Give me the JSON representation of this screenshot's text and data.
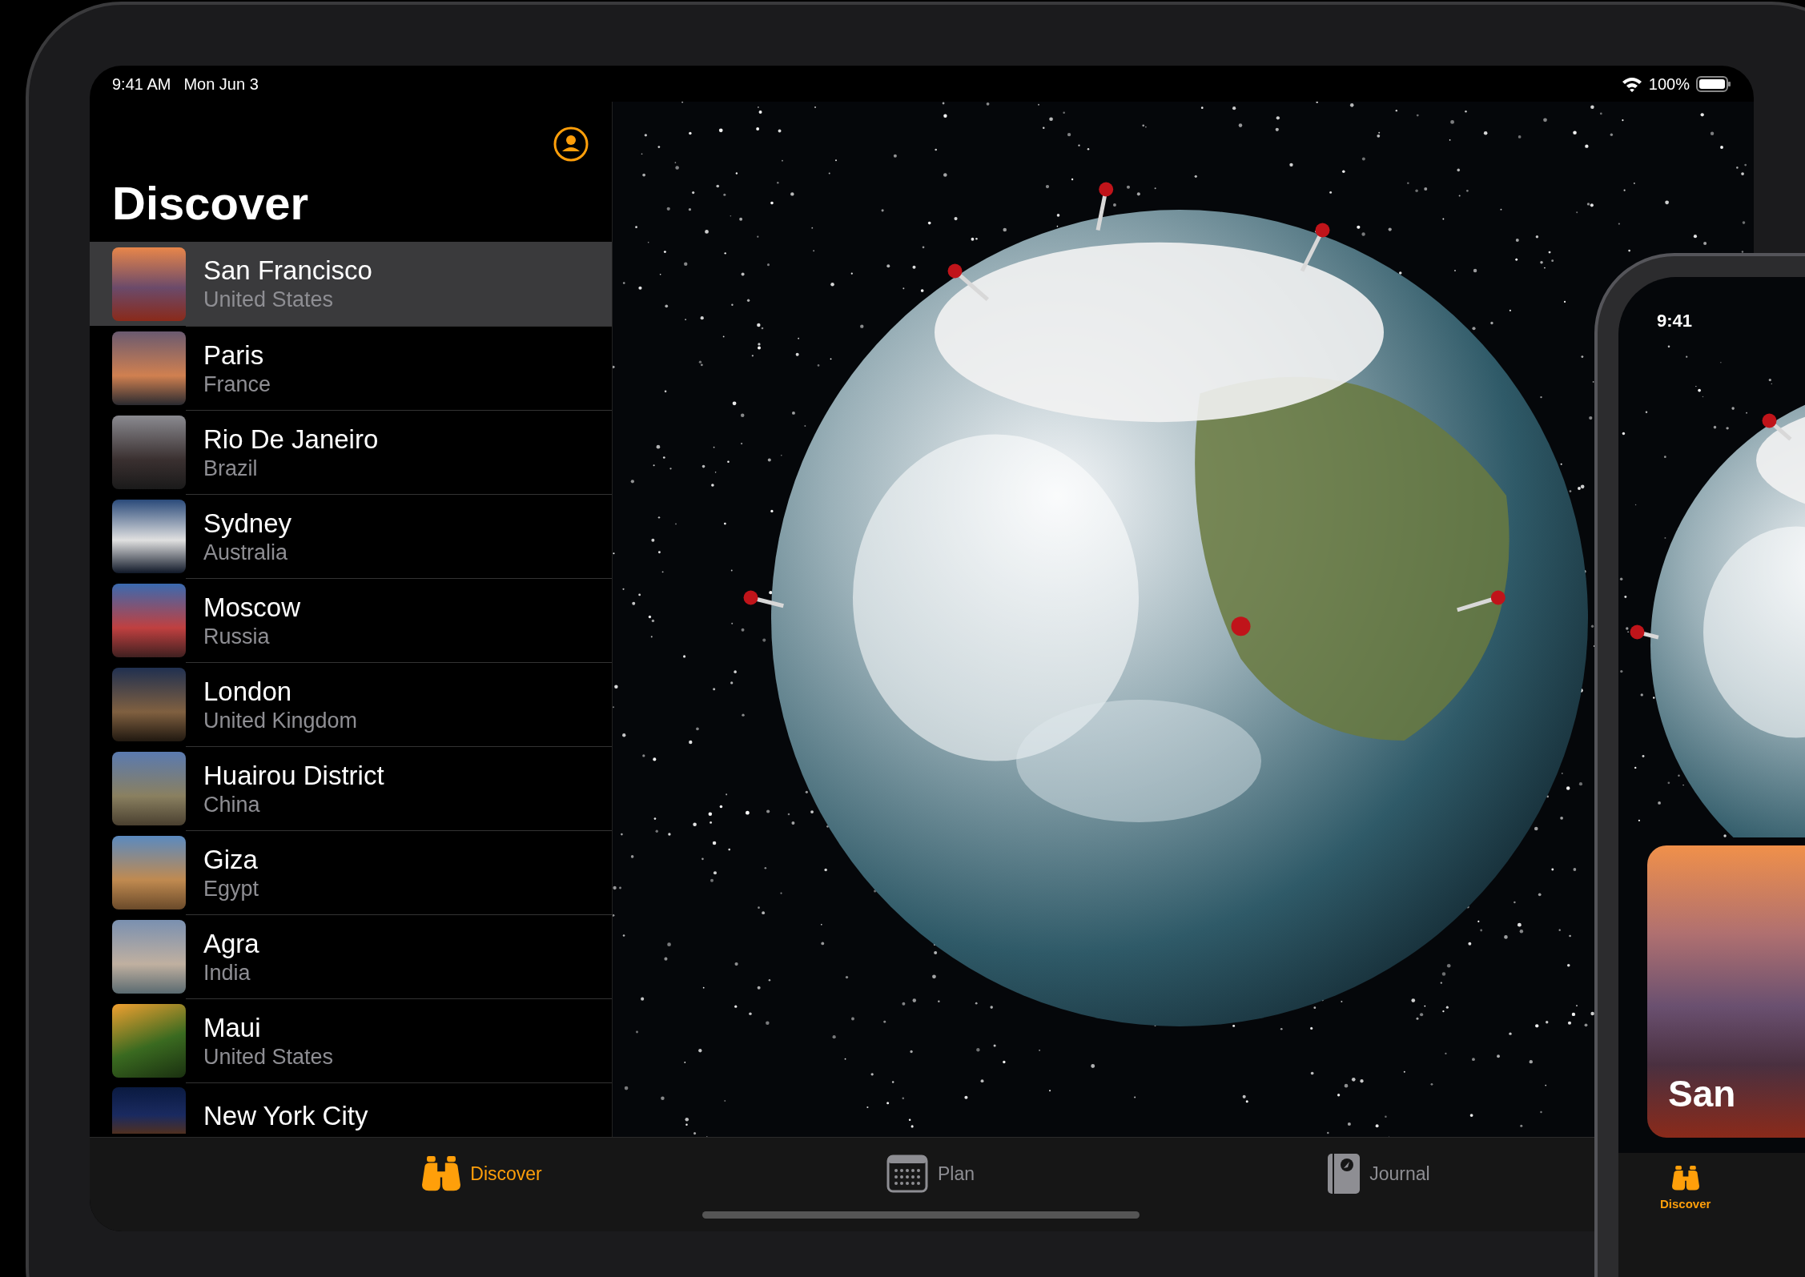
{
  "status_bar": {
    "time": "9:41 AM",
    "date": "Mon Jun 3",
    "battery": "100%"
  },
  "sidebar": {
    "title": "Discover",
    "places": [
      {
        "name": "San Francisco",
        "country": "United States",
        "selected": true
      },
      {
        "name": "Paris",
        "country": "France",
        "selected": false
      },
      {
        "name": "Rio De Janeiro",
        "country": "Brazil",
        "selected": false
      },
      {
        "name": "Sydney",
        "country": "Australia",
        "selected": false
      },
      {
        "name": "Moscow",
        "country": "Russia",
        "selected": false
      },
      {
        "name": "London",
        "country": "United Kingdom",
        "selected": false
      },
      {
        "name": "Huairou District",
        "country": "China",
        "selected": false
      },
      {
        "name": "Giza",
        "country": "Egypt",
        "selected": false
      },
      {
        "name": "Agra",
        "country": "India",
        "selected": false
      },
      {
        "name": "Maui",
        "country": "United States",
        "selected": false
      },
      {
        "name": "New York City",
        "selected": false
      }
    ]
  },
  "tab_bar": {
    "tabs": [
      {
        "label": "Discover",
        "kind": "binoculars",
        "selected": true
      },
      {
        "label": "Plan",
        "kind": "calendar",
        "selected": false
      },
      {
        "label": "Journal",
        "kind": "journal",
        "selected": false
      }
    ]
  },
  "phone": {
    "status_bar": {
      "time": "9:41"
    },
    "card": {
      "title": "San"
    },
    "tab_bar": {
      "tabs": [
        {
          "label": "Discover",
          "kind": "binoculars",
          "selected": true
        }
      ]
    }
  }
}
